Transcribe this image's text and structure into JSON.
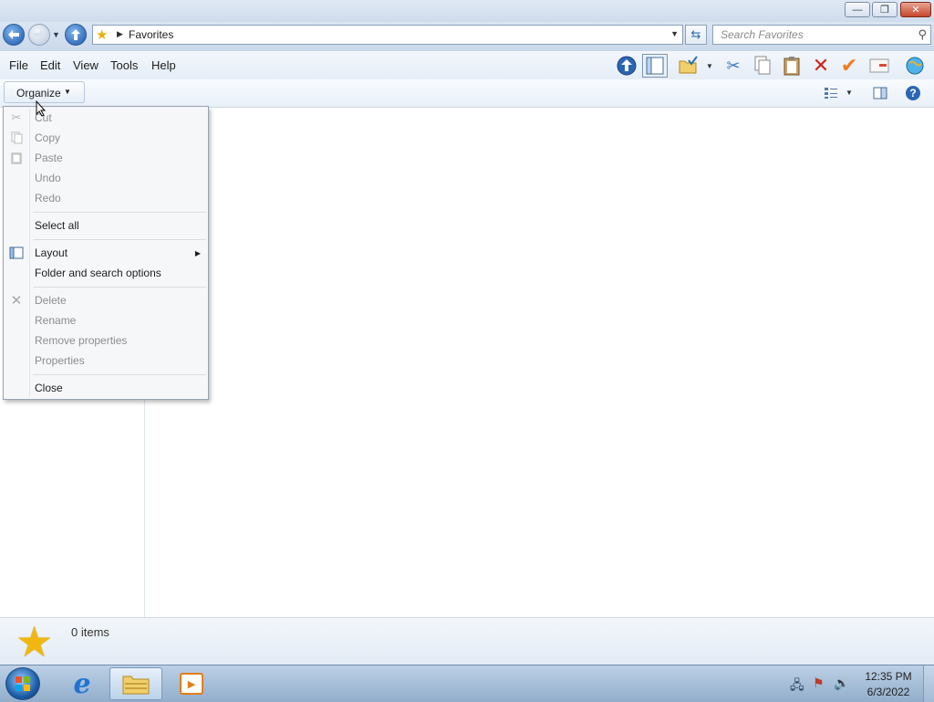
{
  "window": {
    "controls": {
      "minimize": "—",
      "maximize": "❐",
      "close": "✕"
    }
  },
  "address": {
    "crumb": "Favorites",
    "search_placeholder": "Search Favorites"
  },
  "menubar": {
    "items": [
      "File",
      "Edit",
      "View",
      "Tools",
      "Help"
    ]
  },
  "toolbar_icons": [
    "up-icon",
    "pane-icon",
    "folder-check-icon",
    "scissors-icon",
    "copy-icon",
    "clipboard-icon",
    "delete-icon",
    "checkmark-icon",
    "envelope-icon",
    "globe-icon"
  ],
  "cmdbar": {
    "organize_label": "Organize"
  },
  "organize_menu": {
    "items": [
      {
        "label": "Cut",
        "enabled": false,
        "icon": "scissors-icon"
      },
      {
        "label": "Copy",
        "enabled": false,
        "icon": "copy-icon"
      },
      {
        "label": "Paste",
        "enabled": false,
        "icon": "paste-icon"
      },
      {
        "label": "Undo",
        "enabled": false
      },
      {
        "label": "Redo",
        "enabled": false
      },
      {
        "label": "Select all",
        "enabled": true
      },
      {
        "label": "Layout",
        "enabled": true,
        "icon": "layout-icon",
        "submenu": true
      },
      {
        "label": "Folder and search options",
        "enabled": true
      },
      {
        "label": "Delete",
        "enabled": false,
        "icon": "delete-icon"
      },
      {
        "label": "Rename",
        "enabled": false
      },
      {
        "label": "Remove properties",
        "enabled": false
      },
      {
        "label": "Properties",
        "enabled": false
      },
      {
        "label": "Close",
        "enabled": true
      }
    ]
  },
  "details": {
    "items_count": "0 items"
  },
  "taskbar": {
    "ie_glyph": "e",
    "clock_time": "12:35 PM",
    "clock_date": "6/3/2022"
  },
  "colors": {
    "accent": "#1d57a8",
    "menu_disabled": "#8d8d8d",
    "star": "#f1b711"
  }
}
